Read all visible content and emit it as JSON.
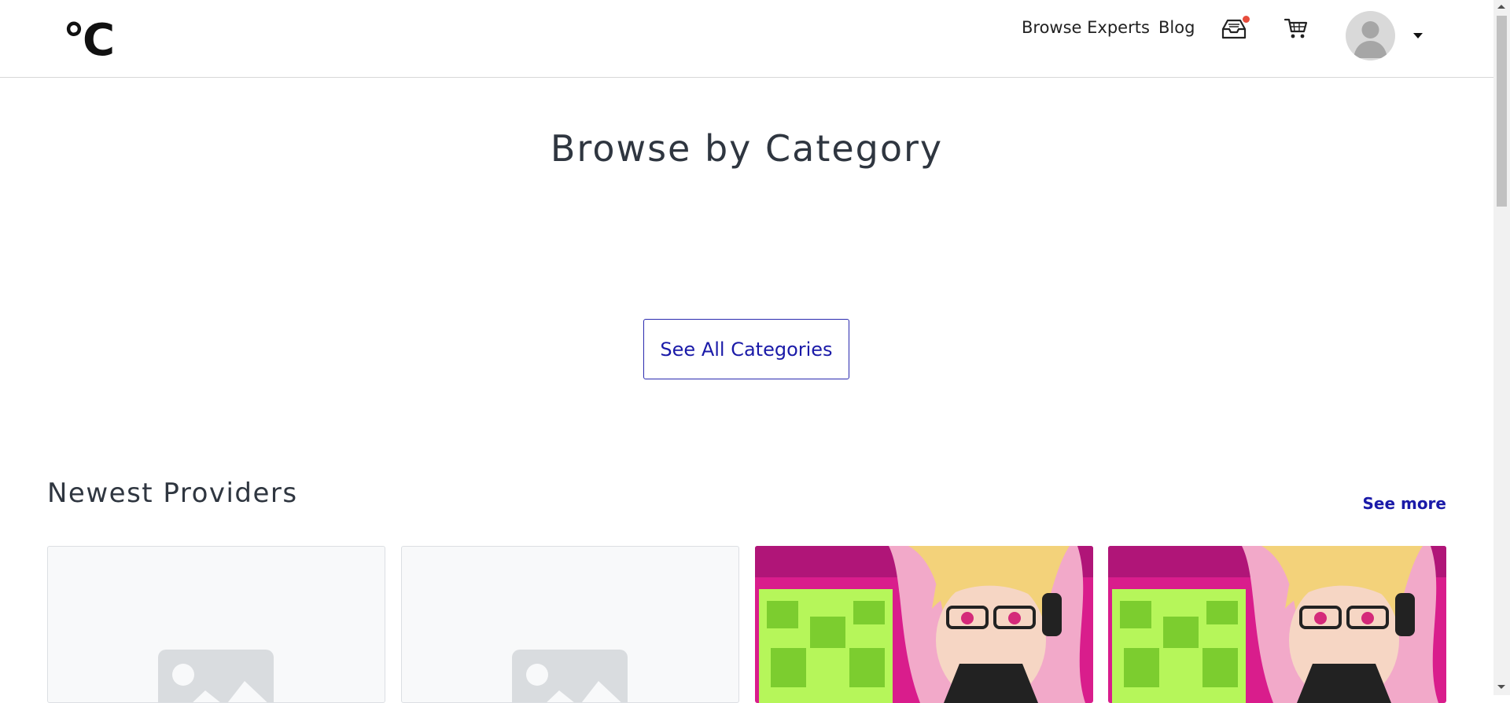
{
  "header": {
    "logo": "°C",
    "nav": {
      "browse_experts": "Browse Experts",
      "blog": "Blog"
    },
    "icons": {
      "inbox": "inbox-icon",
      "cart": "cart-icon",
      "avatar": "avatar",
      "caret": "caret-down-icon"
    }
  },
  "main": {
    "title": "Browse by Category",
    "see_all_label": "See All Categories",
    "newest": {
      "title": "Newest Providers",
      "see_more": "See more"
    }
  },
  "colors": {
    "accent": "#1a1aa8",
    "title": "#2f3640",
    "badge": "#e74c3c",
    "art_pink": "#e8239b",
    "art_green": "#b6f65a"
  }
}
